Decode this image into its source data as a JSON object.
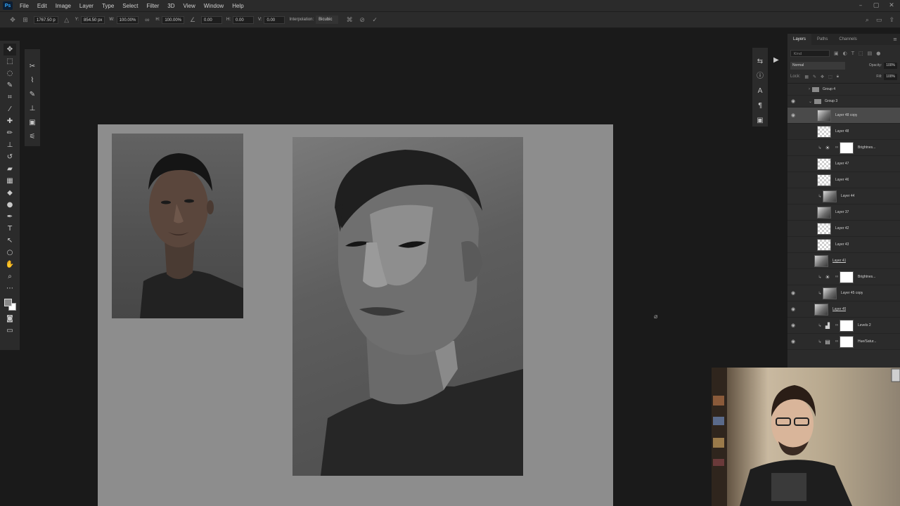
{
  "app": {
    "logo": "Ps"
  },
  "menu": [
    "File",
    "Edit",
    "Image",
    "Layer",
    "Type",
    "Select",
    "Filter",
    "3D",
    "View",
    "Window",
    "Help"
  ],
  "options": {
    "x_value": "1767.50 p",
    "y_label": "Y:",
    "y_value": "854.50 px",
    "w_label": "W:",
    "w_value": "100.00%",
    "h_label": "H:",
    "h_value": "100.00%",
    "angle_value": "0.00",
    "hskew_label": "H:",
    "hskew_value": "0.00",
    "vskew_label": "V:",
    "vskew_value": "0.00",
    "interpolation_label": "Interpolation:",
    "interpolation_value": "Bicubic"
  },
  "layers_panel": {
    "tabs": [
      "Layers",
      "Paths",
      "Channels"
    ],
    "filter_placeholder": "Kind",
    "blend_mode": "Normal",
    "opacity_label": "Opacity:",
    "opacity_value": "100%",
    "lock_label": "Lock:",
    "fill_label": "Fill:",
    "fill_value": "100%",
    "layers": [
      {
        "name": "Group 4",
        "kind": "group",
        "expanded": false,
        "visible": false
      },
      {
        "name": "Group 3",
        "kind": "group",
        "expanded": true,
        "visible": true
      },
      {
        "name": "Layer 48 copy",
        "kind": "pixel-face",
        "visible": true,
        "selected": true
      },
      {
        "name": "Layer 48",
        "kind": "pixel",
        "visible": false
      },
      {
        "name": "Brightnes...",
        "kind": "adjustment-brightness",
        "visible": false,
        "clipped": true
      },
      {
        "name": "Layer 47",
        "kind": "pixel",
        "visible": false
      },
      {
        "name": "Layer 46",
        "kind": "pixel",
        "visible": false
      },
      {
        "name": "Layer 44",
        "kind": "pixel-face",
        "visible": false,
        "clipped": true
      },
      {
        "name": "Layer 37",
        "kind": "pixel-face",
        "visible": false
      },
      {
        "name": "Layer 42",
        "kind": "pixel",
        "visible": false
      },
      {
        "name": "Layer 43",
        "kind": "pixel",
        "visible": false
      },
      {
        "name": "Layer 41",
        "kind": "pixel-face",
        "visible": false,
        "underline": true,
        "noindent": true
      },
      {
        "name": "Brightnes...",
        "kind": "adjustment-brightness",
        "visible": false,
        "clipped": true
      },
      {
        "name": "Layer 45 copy",
        "kind": "pixel-face",
        "visible": true,
        "clipped": true
      },
      {
        "name": "Layer 45",
        "kind": "pixel-face",
        "visible": true,
        "underline": true,
        "noindent": true
      },
      {
        "name": "Levels 2",
        "kind": "adjustment-levels",
        "visible": true,
        "clipped": true
      },
      {
        "name": "Hue/Satur...",
        "kind": "adjustment-hue",
        "visible": true,
        "clipped": true
      }
    ]
  },
  "icons": {
    "adjustment-brightness": "☀",
    "adjustment-levels": "▟",
    "adjustment-hue": "▤"
  }
}
